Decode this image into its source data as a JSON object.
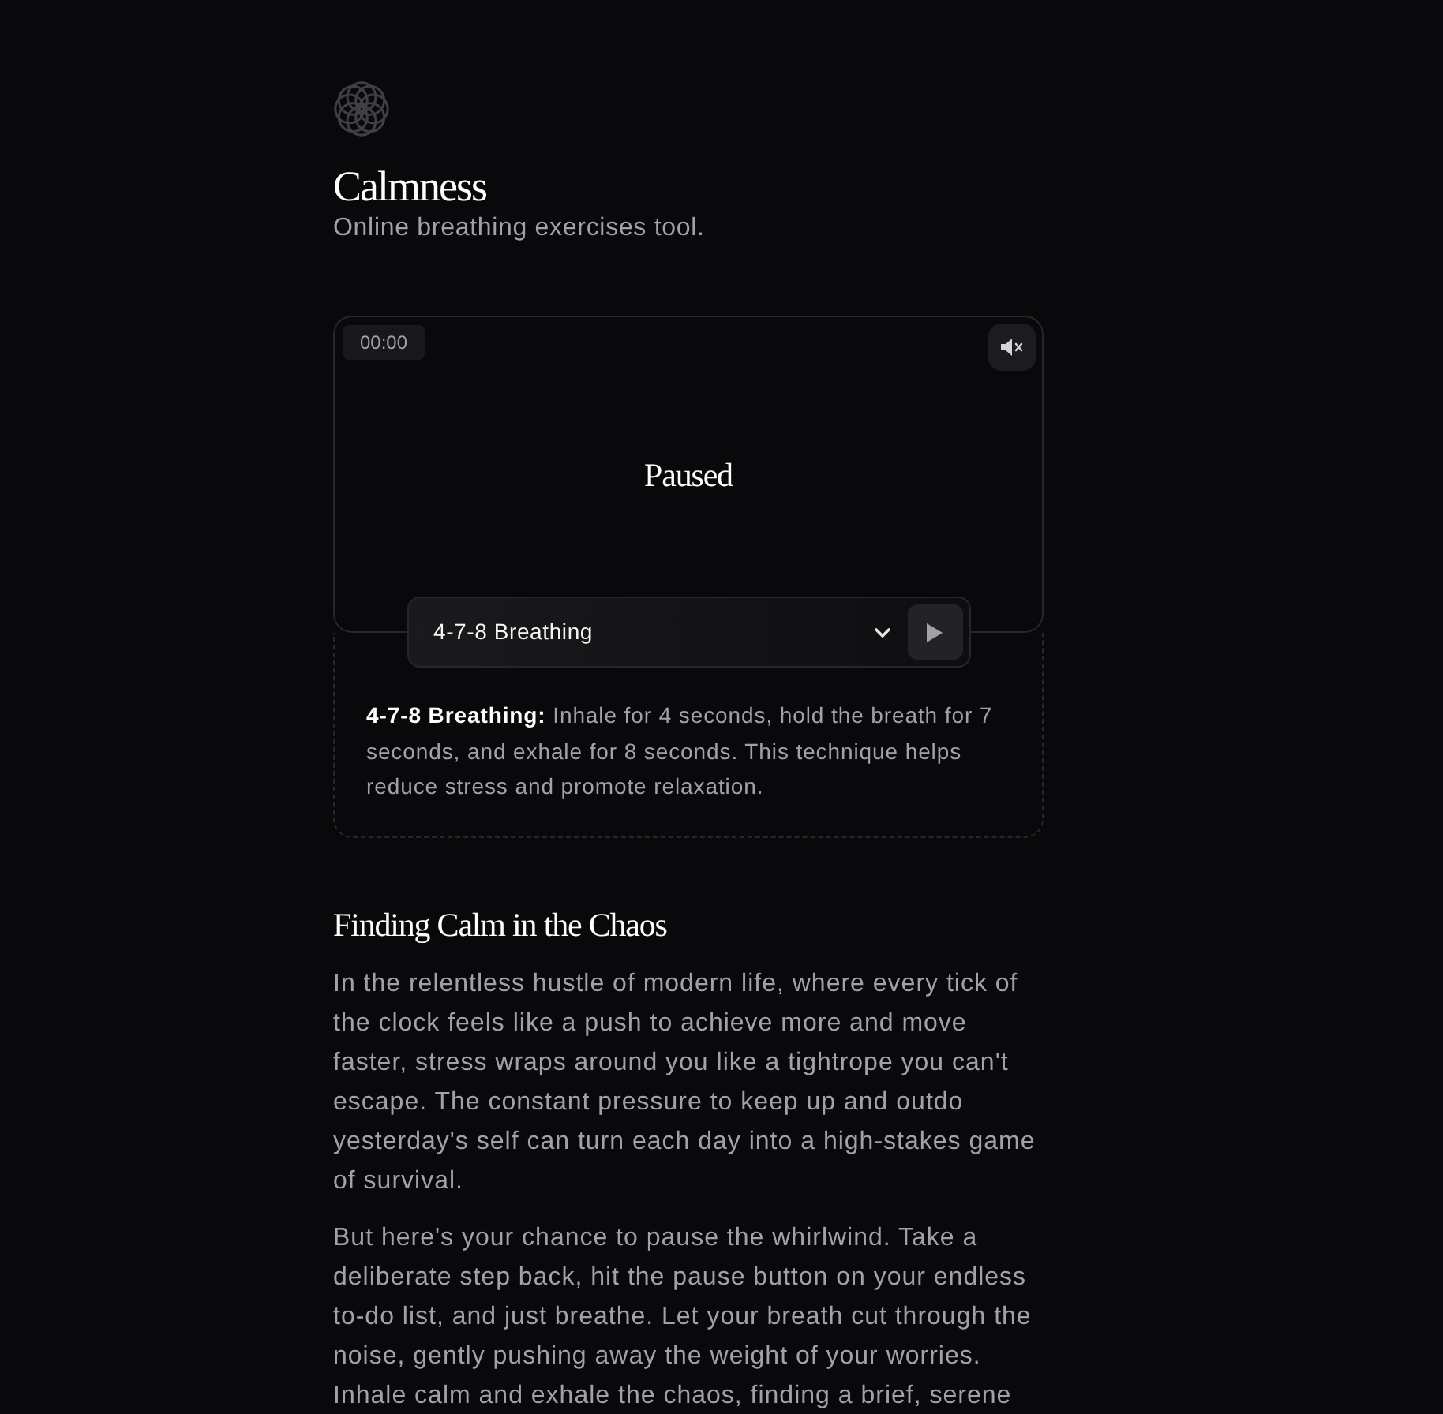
{
  "header": {
    "title": "Calmness",
    "subtitle": "Online breathing exercises tool."
  },
  "player": {
    "timer": "00:00",
    "muted": true,
    "status": "Paused",
    "exercise": "4-7-8 Breathing",
    "playing": false
  },
  "description": "**4-7-8 Breathing:** Inhale for 4 seconds, hold the breath for 7 seconds, and exhale for 8 seconds. This technique helps reduce stress and promote relaxation.",
  "article": {
    "heading": "Finding Calm in the Chaos",
    "paragraphs": [
      "In the relentless hustle of modern life, where every tick of the clock feels like a push to achieve more and move faster, stress wraps around you like a tightrope you can't escape. The constant pressure to keep up and outdo yesterday's self can turn each day into a high-stakes game of survival.",
      "But here's your chance to pause the whirlwind. Take a deliberate step back, hit the pause button on your endless to-do list, and just breathe. Let your breath cut through the noise, gently pushing away the weight of your worries. Inhale calm and exhale the chaos, finding a brief, serene"
    ]
  }
}
